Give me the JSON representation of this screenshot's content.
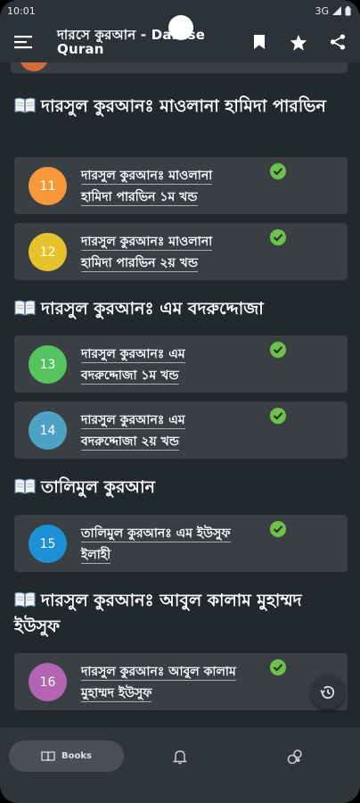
{
  "status": {
    "time": "10:01",
    "network": "3G"
  },
  "app_bar": {
    "title": "দারসে কুরআন - Darase Quran"
  },
  "sections": [
    {
      "title": "দারসুল কুরআনঃ মাওলানা হামিদা পারভিন",
      "items": [
        {
          "num": "11",
          "color": "#f5993b",
          "line1": "দারসুল কুরআনঃ মাওলানা",
          "line2": "হামিদা পারভিন ১ম খন্ড"
        },
        {
          "num": "12",
          "color": "#e6c32d",
          "line1": "দারসুল কুরআনঃ মাওলানা",
          "line2": "হামিদা পারভিন ২য় খন্ড"
        }
      ]
    },
    {
      "title": "দারসুল কুরআনঃ এম বদরুদ্দোজা",
      "items": [
        {
          "num": "13",
          "color": "#55c35e",
          "line1": "দারসুল কুরআনঃ এম",
          "line2": "বদরুদ্দোজা ১ম খন্ড"
        },
        {
          "num": "14",
          "color": "#4ea3c4",
          "line1": "দারসুল কুরআনঃ এম",
          "line2": "বদরুদ্দোজা ২য় খন্ড"
        }
      ]
    },
    {
      "title": "তালিমুল কুরআন",
      "items": [
        {
          "num": "15",
          "color": "#1d90d6",
          "line1": "তালিমুল কুরআনঃ এম ইউসুফ",
          "line2": "ইলাহী"
        }
      ]
    },
    {
      "title": "দারসুল কুরআনঃ আবুল কালাম মুহাম্মদ ইউসুফ",
      "items": [
        {
          "num": "16",
          "color": "#b365b3",
          "line1": "দারসুল কুরআনঃ আবুল কালাম",
          "line2": "মুহাম্মদ ইউসুফ"
        }
      ]
    }
  ],
  "check_color": "#6cc24a",
  "nav": {
    "books_label": "Books"
  }
}
